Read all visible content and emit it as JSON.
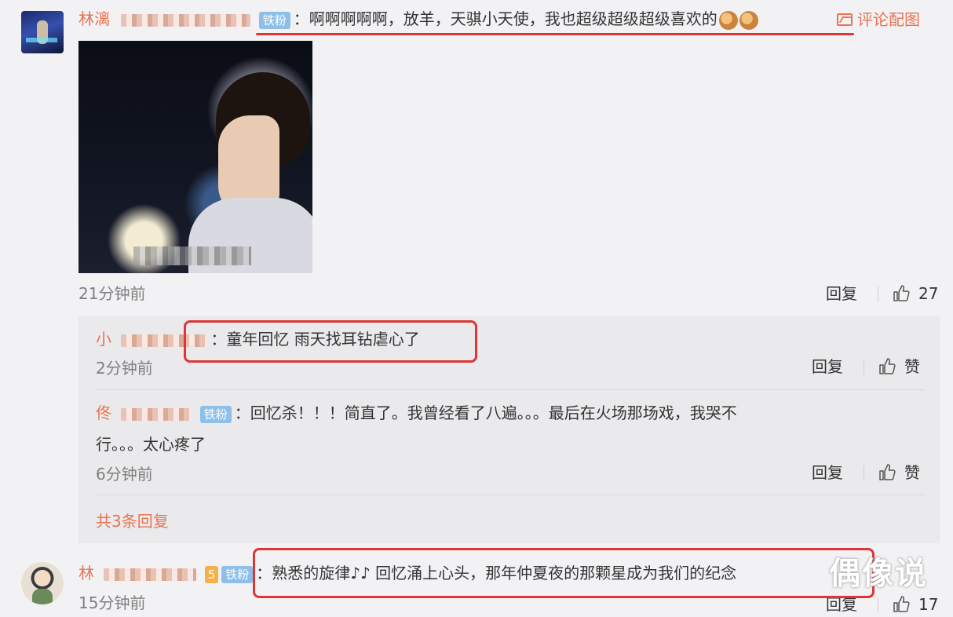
{
  "comment1": {
    "username": "林漓",
    "badge": "铁粉",
    "separator": "：",
    "text": "啊啊啊啊啊，放羊，天骐小天使，我也超级超级超级喜欢的",
    "pic_link": "评论配图",
    "time": "21分钟前",
    "reply_label": "回复",
    "like_count": "27"
  },
  "replies": [
    {
      "username": "小",
      "separator": "：",
      "text": "童年回忆 雨天找耳钻虐心了",
      "time": "2分钟前",
      "reply_label": "回复",
      "like_label": "赞"
    },
    {
      "username": "佟",
      "badge": "铁粉",
      "separator": "：",
      "text_line1": "回忆杀！！！简直了。我曾经看了八遍。。。最后在火场那场戏，我哭不",
      "text_line2": "行。。。太心疼了",
      "time": "6分钟前",
      "reply_label": "回复",
      "like_label": "赞"
    }
  ],
  "more_replies": "共3条回复",
  "comment2": {
    "username": "林",
    "level": "5",
    "badge": "铁粉",
    "separator": "：",
    "text": "熟悉的旋律♪♪ 回忆涌上心头，那年仲夏夜的那颗星成为我们的纪念",
    "time": "15分钟前",
    "reply_label": "回复",
    "like_count": "17"
  },
  "watermark": "偶像说",
  "colors": {
    "accent": "#eb7350",
    "highlight": "#e03535",
    "reply_bg": "#eaeaec",
    "page_bg": "#f2f2f5"
  }
}
